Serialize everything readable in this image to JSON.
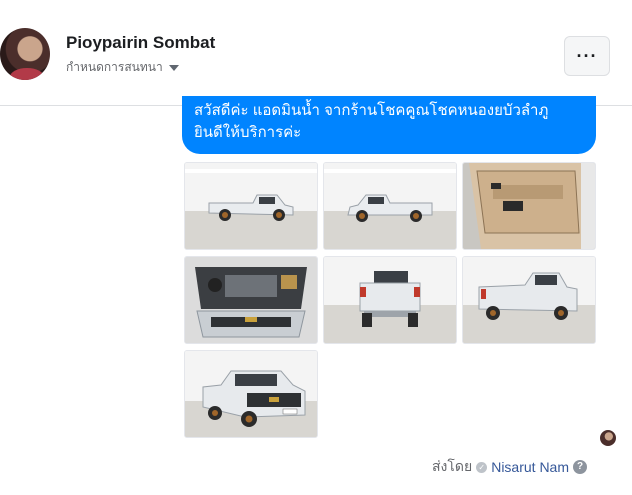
{
  "header": {
    "name": "Pioypairin Sombat",
    "subtitle": "กำหนดการสนทนา",
    "more_label": "···"
  },
  "message": {
    "line1": "สวัสดีค่ะ แอดมินน้ำ จากร้านโชคคูณโชคหนองยบัวลำภู",
    "line2": "ยินดีให้บริการค่ะ"
  },
  "photos": [
    {
      "subject": "pickup-side-view"
    },
    {
      "subject": "pickup-side-view"
    },
    {
      "subject": "door-interior"
    },
    {
      "subject": "engine-bay"
    },
    {
      "subject": "pickup-rear-view"
    },
    {
      "subject": "pickup-rear-quarter-view"
    },
    {
      "subject": "pickup-front-quarter-view"
    }
  ],
  "footer": {
    "sent_by_label": "ส่งโดย",
    "sender": "Nisarut Nam",
    "help_icon": "?"
  },
  "colors": {
    "bubble": "#0084ff",
    "sender_link": "#365899"
  }
}
